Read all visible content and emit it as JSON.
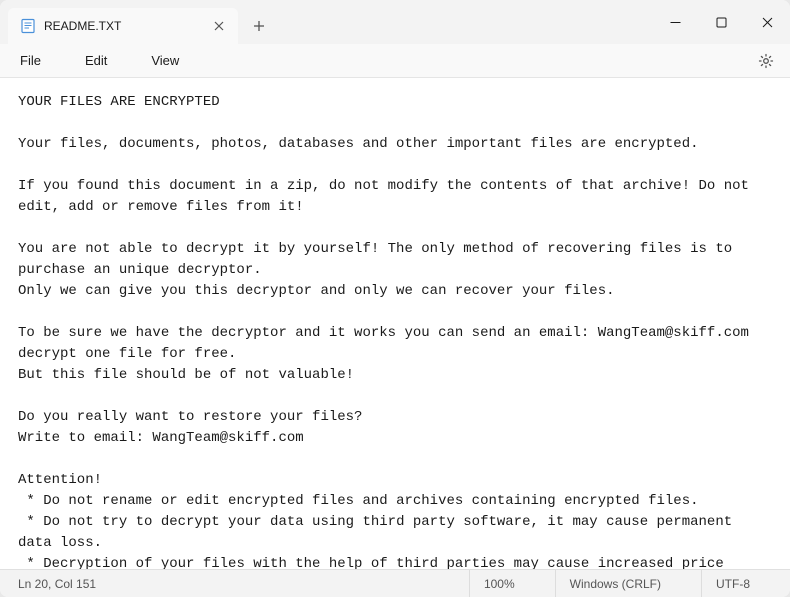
{
  "titlebar": {
    "tab_title": "README.TXT"
  },
  "menu": {
    "file": "File",
    "edit": "Edit",
    "view": "View"
  },
  "content": {
    "body": "YOUR FILES ARE ENCRYPTED\n\nYour files, documents, photos, databases and other important files are encrypted.\n\nIf you found this document in a zip, do not modify the contents of that archive! Do not edit, add or remove files from it!\n\nYou are not able to decrypt it by yourself! The only method of recovering files is to purchase an unique decryptor.\nOnly we can give you this decryptor and only we can recover your files.\n\nTo be sure we have the decryptor and it works you can send an email: WangTeam@skiff.com decrypt one file for free.\nBut this file should be of not valuable!\n\nDo you really want to restore your files?\nWrite to email: WangTeam@skiff.com\n\nAttention!\n * Do not rename or edit encrypted files and archives containing encrypted files.\n * Do not try to decrypt your data using third party software, it may cause permanent data loss.\n * Decryption of your files with the help of third parties may cause increased price (they add their fee to our) or you can become a victim of a scam."
  },
  "statusbar": {
    "position": "Ln 20, Col 151",
    "zoom": "100%",
    "line_endings": "Windows (CRLF)",
    "encoding": "UTF-8"
  }
}
